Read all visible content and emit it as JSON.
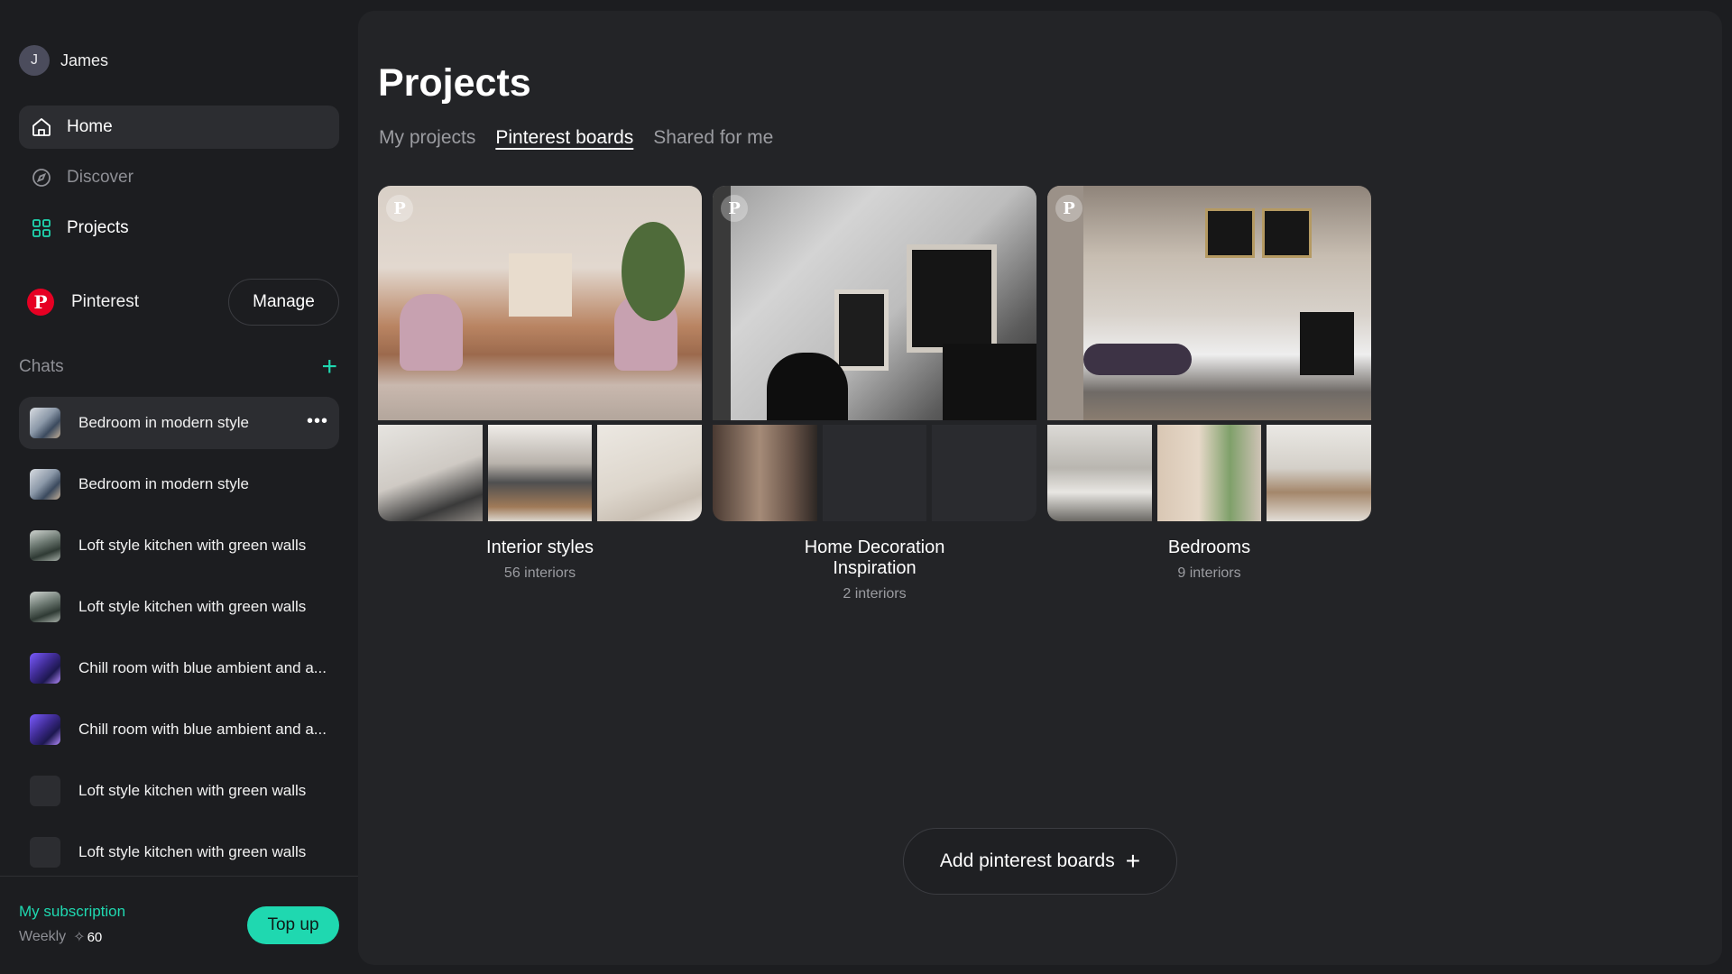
{
  "user": {
    "initial": "J",
    "name": "James"
  },
  "nav": [
    {
      "label": "Home",
      "icon": "home-icon",
      "state": "active"
    },
    {
      "label": "Discover",
      "icon": "compass-icon",
      "state": "muted"
    },
    {
      "label": "Projects",
      "icon": "grid-icon",
      "state": "normal"
    }
  ],
  "pinterest": {
    "logo": "P",
    "label": "Pinterest",
    "manage_label": "Manage"
  },
  "chats": {
    "title": "Chats",
    "add_icon": "+",
    "items": [
      {
        "label": "Bedroom in modern style",
        "active": true
      },
      {
        "label": "Bedroom in modern style"
      },
      {
        "label": "Loft style kitchen with green walls"
      },
      {
        "label": "Loft style kitchen with green walls"
      },
      {
        "label": "Chill room with blue ambient and a..."
      },
      {
        "label": "Chill room with blue ambient and a..."
      },
      {
        "label": "Loft style kitchen with green walls"
      },
      {
        "label": "Loft style kitchen with green walls"
      }
    ],
    "more_icon": "•••"
  },
  "subscription": {
    "title": "My subscription",
    "plan": "Weekly",
    "credits_icon": "✧",
    "credits": "60",
    "topup_label": "Top up"
  },
  "main": {
    "title": "Projects",
    "tabs": [
      {
        "label": "My projects",
        "active": false
      },
      {
        "label": "Pinterest boards",
        "active": true
      },
      {
        "label": "Shared for me",
        "active": false
      }
    ],
    "boards": [
      {
        "name": "Interior styles",
        "count": "56 interiors"
      },
      {
        "name": "Home Decoration Inspiration",
        "count": "2 interiors"
      },
      {
        "name": "Bedrooms",
        "count": "9 interiors"
      }
    ],
    "pin_badge": "P",
    "add_boards_label": "Add pinterest boards",
    "add_boards_icon": "+"
  },
  "colors": {
    "accent": "#1fd8b0",
    "pinterest": "#e60023",
    "panel": "#232427",
    "sidebar": "#1c1d20"
  }
}
